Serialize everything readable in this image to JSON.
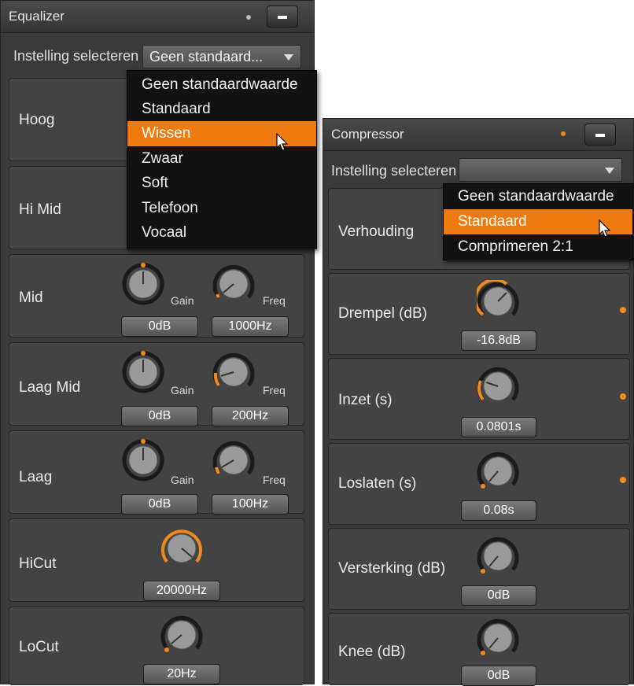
{
  "accent_color": "#ee7a10",
  "equalizer": {
    "title": "Equalizer",
    "preset_label": "Instelling selecteren",
    "preset_value": "Geen standaard...",
    "dropdown": {
      "items": [
        "Geen standaardwaarde",
        "Standaard",
        "Wissen",
        "Zwaar",
        "Soft",
        "Telefoon",
        "Vocaal"
      ],
      "highlighted": "Wissen"
    },
    "rows": [
      {
        "label": "Hoog"
      },
      {
        "label": "Hi Mid"
      },
      {
        "label": "Mid",
        "gain_label": "Gain",
        "gain_value": "0dB",
        "freq_label": "Freq",
        "freq_value": "1000Hz"
      },
      {
        "label": "Laag Mid",
        "gain_label": "Gain",
        "gain_value": "0dB",
        "freq_label": "Freq",
        "freq_value": "200Hz"
      },
      {
        "label": "Laag",
        "gain_label": "Gain",
        "gain_value": "0dB",
        "freq_label": "Freq",
        "freq_value": "100Hz"
      },
      {
        "label": "HiCut",
        "value": "20000Hz"
      },
      {
        "label": "LoCut",
        "value": "20Hz"
      }
    ]
  },
  "compressor": {
    "title": "Compressor",
    "preset_label": "Instelling selecteren",
    "preset_value": "",
    "dropdown": {
      "items": [
        "Geen standaardwaarde",
        "Standaard",
        "Comprimeren 2:1"
      ],
      "highlighted": "Standaard"
    },
    "rows": [
      {
        "label": "Verhouding"
      },
      {
        "label": "Drempel (dB)",
        "value": "-16.8dB"
      },
      {
        "label": "Inzet (s)",
        "value": "0.0801s"
      },
      {
        "label": "Loslaten (s)",
        "value": "0.08s"
      },
      {
        "label": "Versterking (dB)",
        "value": "0dB"
      },
      {
        "label": "Knee (dB)",
        "value": "0dB"
      }
    ]
  }
}
